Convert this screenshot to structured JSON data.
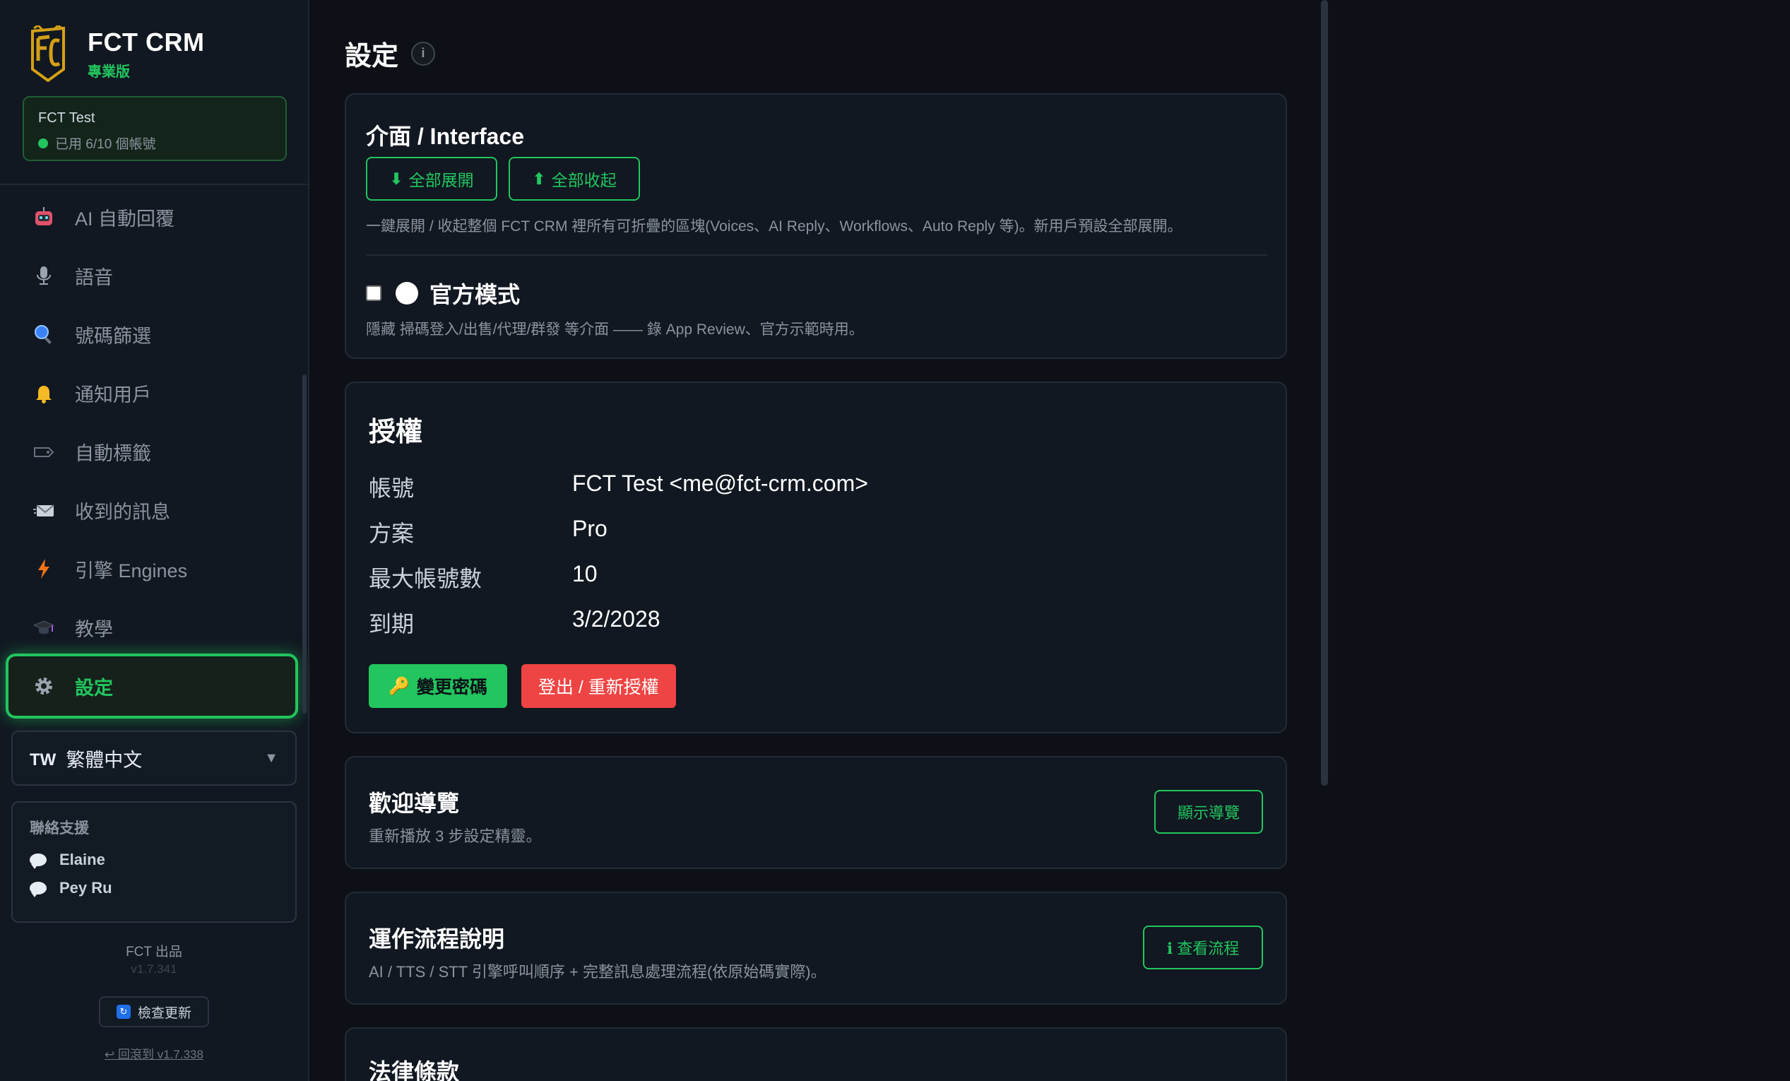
{
  "brand": {
    "title": "FCT CRM",
    "edition": "專業版",
    "logo_color": "#d4a017"
  },
  "account": {
    "name": "FCT Test",
    "usage": "已用 6/10 個帳號"
  },
  "sidebar": {
    "items": [
      {
        "label": "AI 自動回覆",
        "icon": "robot-icon"
      },
      {
        "label": "語音",
        "icon": "microphone-icon"
      },
      {
        "label": "號碼篩選",
        "icon": "magnifier-icon"
      },
      {
        "label": "通知用戶",
        "icon": "bell-icon"
      },
      {
        "label": "自動標籤",
        "icon": "tag-icon"
      },
      {
        "label": "收到的訊息",
        "icon": "inbox-icon"
      },
      {
        "label": "引擎 Engines",
        "icon": "lightning-icon"
      },
      {
        "label": "教學",
        "icon": "graduation-cap-icon"
      },
      {
        "label": "設定",
        "icon": "gear-icon",
        "active": true
      }
    ],
    "language": {
      "code": "TW",
      "label": "繁體中文"
    },
    "support": {
      "title": "聯絡支援",
      "contacts": [
        "Elaine",
        "Pey Ru"
      ]
    },
    "footer": {
      "by": "FCT 出品",
      "version": "v1.7.341",
      "update_button": "檢查更新",
      "rollback_link": "↩ 回滾到 v1.7.338"
    }
  },
  "page": {
    "title": "設定"
  },
  "interface_card": {
    "title": "介面 / Interface",
    "expand_all": "全部展開",
    "collapse_all": "全部收起",
    "desc": "一鍵展開 / 收起整個 FCT CRM 裡所有可折疊的區塊(Voices、AI Reply、Workflows、Auto Reply 等)。新用戶預設全部展開。",
    "official_mode_label": "官方模式",
    "official_mode_checked": false,
    "official_mode_desc": "隱藏 掃碼登入/出售/代理/群發 等介面 —— 錄 App Review、官方示範時用。"
  },
  "license_card": {
    "title": "授權",
    "rows": [
      {
        "key": "帳號",
        "value": "FCT Test <me@fct-crm.com>"
      },
      {
        "key": "方案",
        "value": "Pro"
      },
      {
        "key": "最大帳號數",
        "value": "10"
      },
      {
        "key": "到期",
        "value": "3/2/2028"
      }
    ],
    "change_password": "變更密碼",
    "logout": "登出 / 重新授權"
  },
  "tour_card": {
    "title": "歡迎導覽",
    "desc": "重新播放 3 步設定精靈。",
    "button": "顯示導覽"
  },
  "workflow_card": {
    "title": "運作流程說明",
    "desc": "AI / TTS / STT 引擎呼叫順序 + 完整訊息處理流程(依原始碼實際)。",
    "button": "ℹ 查看流程"
  },
  "legal_card": {
    "title": "法律條款"
  },
  "colors": {
    "accent": "#22c55e",
    "danger": "#ef4444",
    "background": "#0d1117",
    "panel": "#111821"
  }
}
